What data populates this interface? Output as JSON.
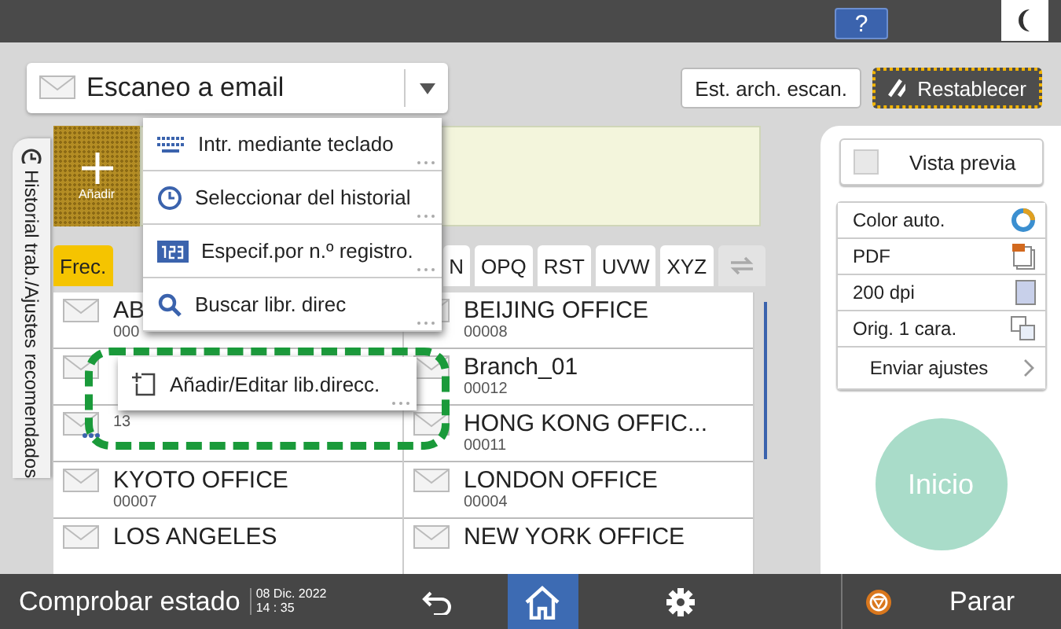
{
  "top_bar": {
    "help_button": "?"
  },
  "function_selector": {
    "label": "Escaneo a email"
  },
  "header_buttons": [
    {
      "label": "Est. arch. escan.",
      "kind": "plain"
    },
    {
      "label": "Restablecer",
      "kind": "reset"
    }
  ],
  "side_tab": {
    "label": "Historial trab./Ajustes recomendados"
  },
  "add_button": {
    "label": "Añadir"
  },
  "index_tabs": [
    {
      "label": "Frec.",
      "selected": true
    },
    {
      "label": "N",
      "selected": false
    },
    {
      "label": "OPQ",
      "selected": false
    },
    {
      "label": "RST",
      "selected": false
    },
    {
      "label": "UVW",
      "selected": false
    },
    {
      "label": "XYZ",
      "selected": false
    }
  ],
  "destinations": {
    "column_1": [
      {
        "name": "AB",
        "number": "000",
        "kind": "email"
      },
      {
        "kind": "email"
      },
      {
        "number": "13",
        "kind": "group"
      },
      {
        "name": "KYOTO OFFICE",
        "number": "00007",
        "kind": "email"
      },
      {
        "name": "LOS ANGELES",
        "kind": "email"
      }
    ],
    "column_2": [
      {
        "name": "BEIJING OFFICE",
        "number": "00008",
        "kind": "email"
      },
      {
        "name": "Branch_01",
        "number": "00012",
        "kind": "email"
      },
      {
        "name": "HONG KONG OFFIC...",
        "number": "00011",
        "kind": "email"
      },
      {
        "name": "LONDON OFFICE",
        "number": "00004",
        "kind": "email"
      },
      {
        "name": "NEW YORK OFFICE",
        "kind": "email"
      }
    ]
  },
  "popup_menu": {
    "items": [
      {
        "label": "Intr. mediante teclado",
        "kind": "keyboard"
      },
      {
        "label": "Seleccionar del historial",
        "kind": "history"
      },
      {
        "label": "Especif.por n.º registro.",
        "kind": "number"
      },
      {
        "label": "Buscar libr. direc",
        "kind": "search"
      }
    ],
    "highlighted_item": {
      "label": "Añadir/Editar lib.direcc."
    }
  },
  "settings": {
    "preview": {
      "label": "Vista previa",
      "checked": false
    },
    "items": [
      {
        "label": "Color auto.",
        "kind": "color"
      },
      {
        "label": "PDF",
        "kind": "pdf"
      },
      {
        "label": "200 dpi",
        "kind": "resolution"
      },
      {
        "label": "Orig. 1 cara.",
        "kind": "sides"
      }
    ],
    "send_settings": "Enviar ajustes",
    "start_button": {
      "label": "Inicio",
      "disabled": true
    }
  },
  "status_bar": {
    "check_status": "Comprobar estado",
    "date": "08 Dic. 2022",
    "time": "14 : 35",
    "nav": [
      {
        "kind": "back",
        "selected": false
      },
      {
        "kind": "home",
        "selected": true
      },
      {
        "kind": "settings",
        "selected": false
      }
    ],
    "stop": "Parar"
  }
}
